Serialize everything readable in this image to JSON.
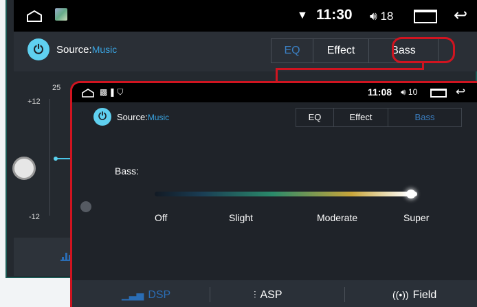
{
  "background": {
    "status": {
      "time": "11:30",
      "volume": "18"
    },
    "source_label": "Source:",
    "source_value": "Music",
    "tabs": [
      {
        "label": "EQ"
      },
      {
        "label": "Effect"
      },
      {
        "label": "Bass"
      }
    ],
    "eq_scale": {
      "top": "25",
      "high": "+12",
      "low": "-12"
    }
  },
  "panel": {
    "status": {
      "time": "11:08",
      "volume": "10"
    },
    "source_label": "Source:",
    "source_value": "Music",
    "tabs": [
      {
        "label": "EQ"
      },
      {
        "label": "Effect"
      },
      {
        "label": "Bass"
      }
    ],
    "bass_label": "Bass:",
    "bass_level": "Super",
    "levels": [
      "Off",
      "Slight",
      "Moderate",
      "Super"
    ],
    "bottom_tabs": [
      {
        "label": "DSP",
        "icon": "equalizer-bars-icon"
      },
      {
        "label": "ASP",
        "icon": "sliders-icon"
      },
      {
        "label": "Field",
        "icon": "sound-field-icon"
      }
    ]
  },
  "colors": {
    "highlight": "#d01420",
    "accent": "#3b7fc2",
    "power": "#5fd0f0"
  }
}
